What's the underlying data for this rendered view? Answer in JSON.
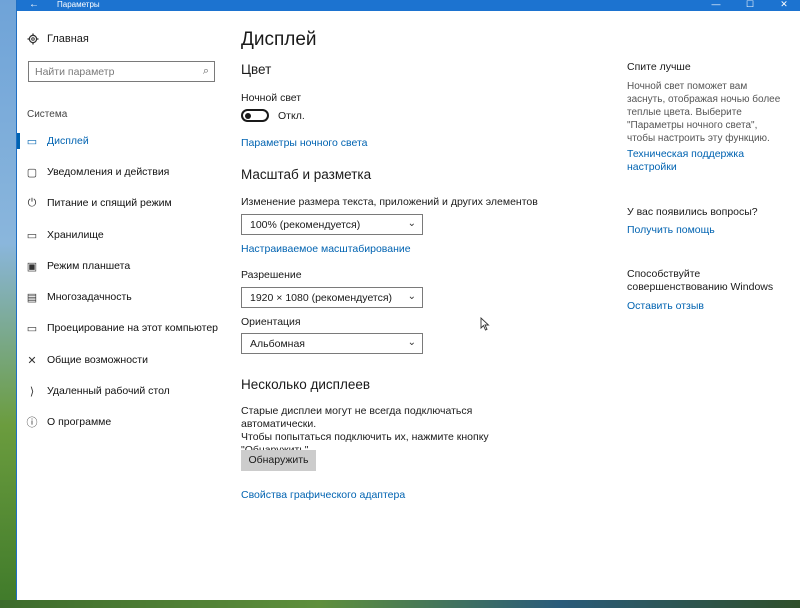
{
  "window": {
    "title": "Параметры",
    "back_icon": "←",
    "minimize_icon": "—",
    "maximize_icon": "☐",
    "close_icon": "✕"
  },
  "nav": {
    "home_label": "Главная",
    "search_placeholder": "Найти параметр",
    "section_label": "Система",
    "items": [
      {
        "label": "Дисплей",
        "icon": "monitor-icon",
        "glyph": "▭",
        "active": true
      },
      {
        "label": "Уведомления и действия",
        "icon": "notifications-icon",
        "glyph": "▢"
      },
      {
        "label": "Питание и спящий режим",
        "icon": "power-icon",
        "glyph": "⏻"
      },
      {
        "label": "Хранилище",
        "icon": "storage-icon",
        "glyph": "▭"
      },
      {
        "label": "Режим планшета",
        "icon": "tablet-icon",
        "glyph": "▣"
      },
      {
        "label": "Многозадачность",
        "icon": "multitasking-icon",
        "glyph": "▤"
      },
      {
        "label": "Проецирование на этот компьютер",
        "icon": "projection-icon",
        "glyph": "▭"
      },
      {
        "label": "Общие возможности",
        "icon": "shared-experiences-icon",
        "glyph": "✕"
      },
      {
        "label": "Удаленный рабочий стол",
        "icon": "remote-desktop-icon",
        "glyph": "⟩"
      },
      {
        "label": "О программе",
        "icon": "info-icon",
        "glyph": "ⓘ"
      }
    ]
  },
  "main": {
    "page_title": "Дисплей",
    "color_heading": "Цвет",
    "night_light_label": "Ночной свет",
    "night_light_state": "Откл.",
    "night_light_settings_link": "Параметры ночного света",
    "scale_heading": "Масштаб и разметка",
    "scale_label": "Изменение размера текста, приложений и других элементов",
    "scale_value": "100% (рекомендуется)",
    "custom_scaling_link": "Настраиваемое масштабирование",
    "resolution_label": "Разрешение",
    "resolution_value": "1920 × 1080 (рекомендуется)",
    "orientation_label": "Ориентация",
    "orientation_value": "Альбомная",
    "multi_display_heading": "Несколько дисплеев",
    "multi_display_text_1": "Старые дисплеи могут не всегда подключаться автоматически.",
    "multi_display_text_2": "Чтобы попытаться подключить их, нажмите кнопку",
    "multi_display_text_3": "\"Обнаружить\".",
    "detect_button": "Обнаружить",
    "adapter_link": "Свойства графического адаптера"
  },
  "side": {
    "sleep_heading": "Спите лучше",
    "sleep_text": "Ночной свет поможет вам заснуть, отображая ночью более теплые цвета. Выберите \"Параметры ночного света\", чтобы настроить эту функцию.",
    "support_link": "Техническая поддержка настройки",
    "questions_heading": "У вас появились вопросы?",
    "help_link": "Получить помощь",
    "improve_text": "Способствуйте совершенствованию Windows",
    "feedback_link": "Оставить отзыв"
  },
  "colors": {
    "accent": "#0063b1",
    "titlebar": "#1c73d0"
  }
}
